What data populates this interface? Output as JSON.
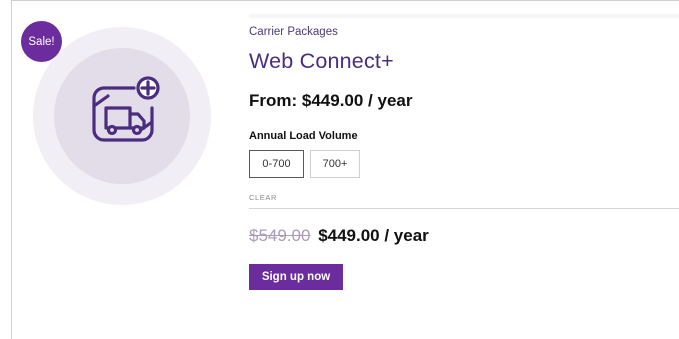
{
  "badge": {
    "label": "Sale!"
  },
  "product": {
    "category": "Carrier Packages",
    "name": "Web Connect+",
    "from_price": "From: $449.00 / year"
  },
  "variation": {
    "label": "Annual Load Volume",
    "options": [
      {
        "label": "0-700",
        "selected": true
      },
      {
        "label": "700+",
        "selected": false
      }
    ],
    "clear_label": "CLEAR"
  },
  "pricing": {
    "old_price": "$549.00",
    "new_price": "$449.00 / year"
  },
  "cta": {
    "label": "Sign up now"
  },
  "colors": {
    "accent": "#6b2d9d",
    "title": "#4b2d7f",
    "circle_outer": "#f1eef6",
    "circle_inner": "#e3dde9"
  },
  "icons": {
    "product": "truck-plus-icon"
  }
}
